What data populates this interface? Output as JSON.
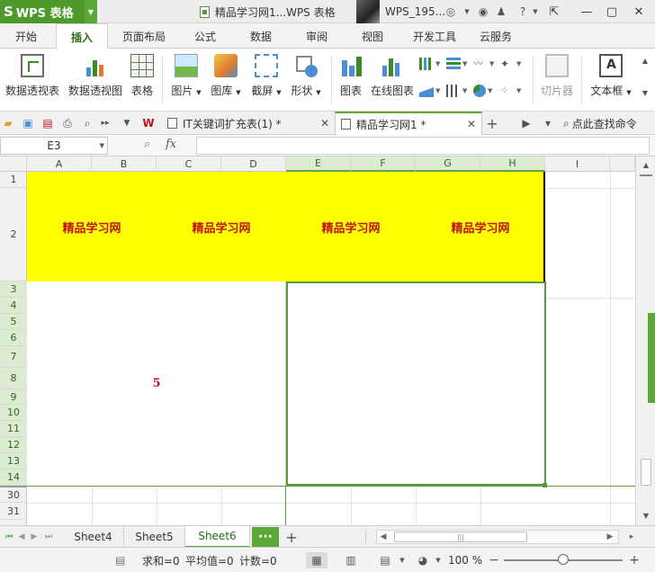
{
  "titlebar": {
    "app_name": "WPS 表格",
    "doc_title": "精品学习网1...WPS 表格",
    "user_name": "WPS_195...",
    "help": "?"
  },
  "ribbon_tabs": [
    "开始",
    "插入",
    "页面布局",
    "公式",
    "数据",
    "审阅",
    "视图",
    "开发工具",
    "云服务"
  ],
  "active_ribbon_tab": "插入",
  "ribbon": {
    "pivot_table": "数据透视表",
    "pivot_chart": "数据透视图",
    "table": "表格",
    "picture": "图片",
    "gallery": "图库",
    "screenshot": "截屏",
    "shapes": "形状",
    "chart": "图表",
    "online_chart": "在线图表",
    "slicer": "切片器",
    "textbox": "文本框"
  },
  "doc_tabs": [
    {
      "label": "IT关键词扩充表(1) *",
      "active": false
    },
    {
      "label": "精品学习网1 *",
      "active": true
    }
  ],
  "find_command": "点此查找命令",
  "formula_bar": {
    "cell_ref": "E3",
    "fx": "fx",
    "formula": ""
  },
  "grid": {
    "columns": [
      "A",
      "B",
      "C",
      "D",
      "E",
      "F",
      "G",
      "H",
      "I"
    ],
    "rows": [
      "1",
      "2",
      "3",
      "4",
      "5",
      "6",
      "7",
      "8",
      "9",
      "10",
      "11",
      "12",
      "13",
      "14",
      "30",
      "31"
    ],
    "merged_text": [
      "精品学习网",
      "精品学习网",
      "精品学习网",
      "精品学习网"
    ],
    "value_5": "5"
  },
  "sheets": [
    "Sheet4",
    "Sheet5",
    "Sheet6"
  ],
  "active_sheet": "Sheet6",
  "more_sheets": "···",
  "add_sheet": "+",
  "status": {
    "sum": "求和=0",
    "avg": "平均值=0",
    "count": "计数=0",
    "zoom": "100 %"
  },
  "colors": {
    "brand_green": "#4c9a2a",
    "highlight_yellow": "#ffff00",
    "cell_text_red": "#c0141c"
  }
}
